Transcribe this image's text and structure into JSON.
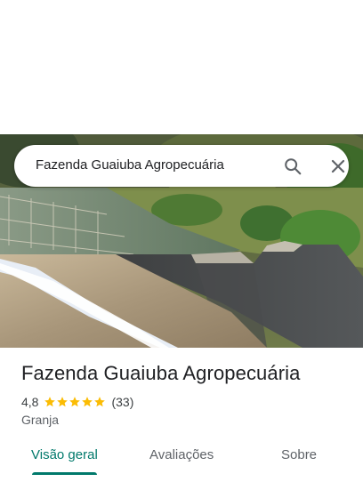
{
  "search": {
    "query": "Fazenda Guaiuba Agropecuária",
    "search_icon": "search-icon",
    "close_icon": "close-icon"
  },
  "hero": {
    "image": "dam-spillway-photo"
  },
  "place": {
    "title": "Fazenda Guaiuba Agropecuária",
    "rating": "4,8",
    "stars": 5,
    "review_count": "(33)",
    "category": "Granja"
  },
  "tabs": [
    {
      "label": "Visão geral",
      "active": true
    },
    {
      "label": "Avaliações",
      "active": false
    },
    {
      "label": "Sobre",
      "active": false
    }
  ],
  "colors": {
    "accent": "#00796b",
    "star": "#fbbc04"
  }
}
